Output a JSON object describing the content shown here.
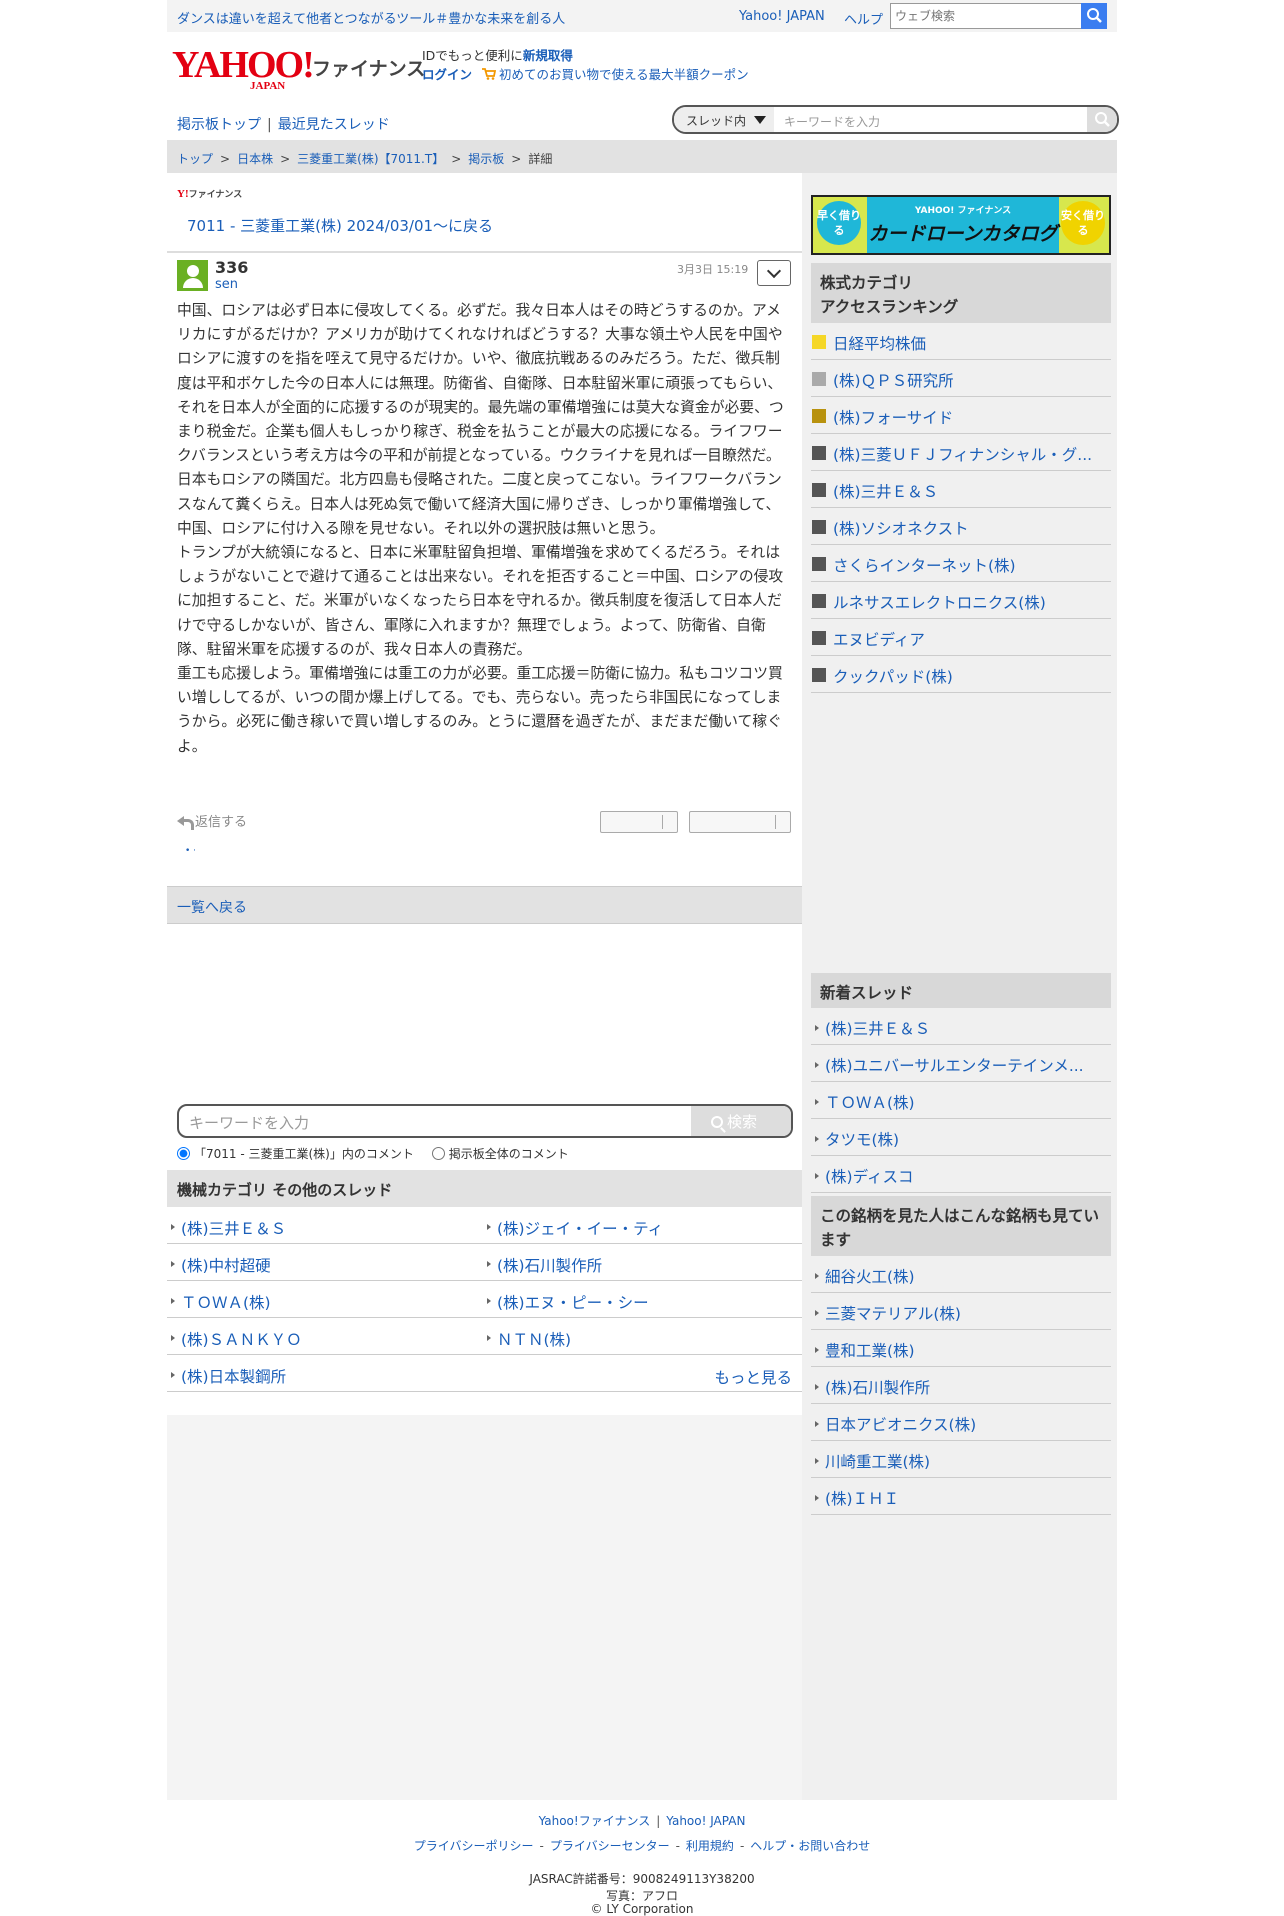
{
  "topbar": {
    "promo": "ダンスは違いを超えて他者とつながるツール＃豊かな未来を創る人",
    "yahoo_japan": "Yahoo! JAPAN",
    "help": "ヘルプ",
    "search_placeholder": "ウェブ検索"
  },
  "header": {
    "logo_yahoo": "YAHOO!",
    "logo_japan": "JAPAN",
    "logo_finance": "ファイナンス",
    "id_text": "IDでもっと便利に",
    "signup": "新規取得",
    "login": "ログイン",
    "coupon": "初めてのお買い物で使える最大半額クーポン"
  },
  "nav": {
    "board_top": "掲示板トップ",
    "sep": "|",
    "recent": "最近見たスレッド",
    "scope": "スレッド内",
    "keyword_placeholder": "キーワードを入力"
  },
  "breadcrumb": [
    "トップ",
    "日本株",
    "三菱重工業(株)【7011.T】",
    "掲示板",
    "詳細"
  ],
  "breadcrumb_sep": ">",
  "thread": {
    "brand": "ファイナンス",
    "brand_y": "Y!",
    "back_link": "7011 - 三菱重工業(株) 2024/03/01〜に戻る"
  },
  "post": {
    "number": "336",
    "author": "sen",
    "date": "3月3日 15:19",
    "body": "中国、ロシアは必ず日本に侵攻してくる。必ずだ。我々日本人はその時どうするのか。アメリカにすがるだけか？アメリカが助けてくれなければどうする？大事な領土や人民を中国やロシアに渡すのを指を咥えて見守るだけか。いや、徹底抗戦あるのみだろう。ただ、徴兵制度は平和ボケした今の日本人には無理。防衛省、自衛隊、日本駐留米軍に頑張ってもらい、それを日本人が全面的に応援するのが現実的。最先端の軍備増強には莫大な資金が必要、つまり税金だ。企業も個人もしっかり稼ぎ、税金を払うことが最大の応援になる。ライフワークバランスという考え方は今の平和が前提となっている。ウクライナを見れば一目瞭然だ。日本もロシアの隣国だ。北方四島も侵略された。二度と戻ってこない。ライフワークバランスなんて糞くらえ。日本人は死ぬ気で働いて経済大国に帰りざき、しっかり軍備増強して、中国、ロシアに付け入る隙を見せない。それ以外の選択肢は無いと思う。\nトランプが大統領になると、日本に米軍駐留負担増、軍備増強を求めてくるだろう。それはしょうがないことで避けて通ることは出来ない。それを拒否すること＝中国、ロシアの侵攻に加担すること、だ。米軍がいなくなったら日本を守れるか。徴兵制度を復活して日本人だけで守るしかないが、皆さん、軍隊に入れますか？無理でしょう。よって、防衛省、自衛隊、駐留米軍を応援するのが、我々日本人の責務だ。\n重工も応援しよう。軍備増強には重工の力が必要。重工応援＝防衛に協力。私もコツコツ買い増ししてるが、いつの間か爆上げしてる。でも、売らない。売ったら非国民になってしまうから。必死に働き稼いで買い増しするのみ。とうに還暦を過ぎたが、まだまだ働いて稼ぐよ。",
    "reply": "返信する",
    "dots": "•             ·"
  },
  "list_back": "一覧へ戻る",
  "search": {
    "placeholder": "キーワードを入力",
    "button": "検索",
    "radio_thread": "「7011 - 三菱重工業(株)」内のコメント",
    "radio_all": "掲示板全体のコメント"
  },
  "other_threads": {
    "title": "機械カテゴリ  その他のスレッド",
    "items": [
      "(株)三井Ｅ＆Ｓ",
      "(株)ジェイ・イー・ティ",
      "(株)中村超硬",
      "(株)石川製作所",
      "ＴＯＷＡ(株)",
      "(株)エヌ・ピー・シー",
      "(株)ＳＡＮＫＹＯ",
      "ＮＴＮ(株)",
      "(株)日本製鋼所"
    ],
    "more": "もっと見る"
  },
  "banner": {
    "left": "早く借りる",
    "brand": "YAHOO! ファイナンス",
    "title": "カードローンカタログ",
    "right": "安く借りる"
  },
  "ranking": {
    "title_line1": "株式カテゴリ",
    "title_line2": "アクセスランキング",
    "items": [
      {
        "label": "日経平均株価",
        "color": "#f5d727"
      },
      {
        "label": "(株)ＱＰＳ研究所",
        "color": "#aaaaaa"
      },
      {
        "label": "(株)フォーサイド",
        "color": "#b8920e"
      },
      {
        "label": "(株)三菱ＵＦＪフィナンシャル・グ...",
        "color": "#555555"
      },
      {
        "label": "(株)三井Ｅ＆Ｓ",
        "color": "#555555"
      },
      {
        "label": "(株)ソシオネクスト",
        "color": "#555555"
      },
      {
        "label": "さくらインターネット(株)",
        "color": "#555555"
      },
      {
        "label": "ルネサスエレクトロニクス(株)",
        "color": "#555555"
      },
      {
        "label": "エヌビディア",
        "color": "#555555"
      },
      {
        "label": "クックパッド(株)",
        "color": "#555555"
      }
    ]
  },
  "new_threads": {
    "title": "新着スレッド",
    "items": [
      "(株)三井Ｅ＆Ｓ",
      "(株)ユニバーサルエンターテインメ...",
      "ＴＯＷＡ(株)",
      "タツモ(株)",
      "(株)ディスコ"
    ]
  },
  "also_viewed": {
    "title": "この銘柄を見た人はこんな銘柄も見ています",
    "items": [
      "細谷火工(株)",
      "三菱マテリアル(株)",
      "豊和工業(株)",
      "(株)石川製作所",
      "日本アビオニクス(株)",
      "川崎重工業(株)",
      "(株)ＩＨＩ"
    ]
  },
  "footer": {
    "yahoo_finance": "Yahoo!ファイナンス",
    "yahoo_japan": "Yahoo! JAPAN",
    "links": [
      "プライバシーポリシー",
      "プライバシーセンター",
      "利用規約",
      "ヘルプ・お問い合わせ"
    ],
    "jasrac": "JASRAC許諾番号：9008249113Y38200",
    "photo": "写真：アフロ",
    "copyright": "© LY Corporation"
  }
}
